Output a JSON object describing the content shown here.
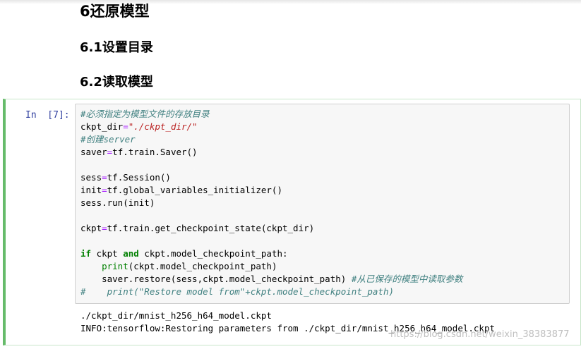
{
  "headings": {
    "h1": "6还原模型",
    "h2_1": "6.1设置目录",
    "h2_2": "6.2读取模型"
  },
  "cell": {
    "prompt": "In  [7]:",
    "code_lines": [
      [
        {
          "t": "#必须指定为模型文件的存放目录",
          "c": "comment"
        }
      ],
      [
        {
          "t": "ckpt_dir",
          "c": ""
        },
        {
          "t": "=",
          "c": "op"
        },
        {
          "t": "\"./ckpt_dir/\"",
          "c": "string"
        }
      ],
      [
        {
          "t": "#创建server",
          "c": "comment"
        }
      ],
      [
        {
          "t": "saver",
          "c": ""
        },
        {
          "t": "=",
          "c": "op"
        },
        {
          "t": "tf.train.Saver()",
          "c": ""
        }
      ],
      [],
      [
        {
          "t": "sess",
          "c": ""
        },
        {
          "t": "=",
          "c": "op"
        },
        {
          "t": "tf.Session()",
          "c": ""
        }
      ],
      [
        {
          "t": "init",
          "c": ""
        },
        {
          "t": "=",
          "c": "op"
        },
        {
          "t": "tf.global_variables_initializer()",
          "c": ""
        }
      ],
      [
        {
          "t": "sess.run(init)",
          "c": ""
        }
      ],
      [],
      [
        {
          "t": "ckpt",
          "c": ""
        },
        {
          "t": "=",
          "c": "op"
        },
        {
          "t": "tf.train.get_checkpoint_state(ckpt_dir)",
          "c": ""
        }
      ],
      [],
      [
        {
          "t": "if",
          "c": "kw"
        },
        {
          "t": " ckpt ",
          "c": ""
        },
        {
          "t": "and",
          "c": "kw"
        },
        {
          "t": " ckpt.model_checkpoint_path:",
          "c": ""
        }
      ],
      [
        {
          "t": "    ",
          "c": ""
        },
        {
          "t": "print",
          "c": "builtin"
        },
        {
          "t": "(ckpt.model_checkpoint_path)",
          "c": ""
        }
      ],
      [
        {
          "t": "    saver.restore(sess,ckpt.model_checkpoint_path) ",
          "c": ""
        },
        {
          "t": "#从已保存的模型中读取参数",
          "c": "comment"
        }
      ],
      [
        {
          "t": "#    print(\"Restore model from\"+ckpt.model_checkpoint_path)",
          "c": "comment"
        }
      ]
    ],
    "output_lines": [
      "./ckpt_dir/mnist_h256_h64_model.ckpt",
      "INFO:tensorflow:Restoring parameters from ./ckpt_dir/mnist_h256_h64_model.ckpt"
    ]
  },
  "watermark": "https://blog.csdn.net/weixin_38383877",
  "colors": {
    "cell_border_active": "#66bb6a",
    "prompt": "#303f9f",
    "comment": "#408080",
    "string": "#ba2121",
    "keyword": "#008000",
    "operator": "#aa22ff"
  }
}
